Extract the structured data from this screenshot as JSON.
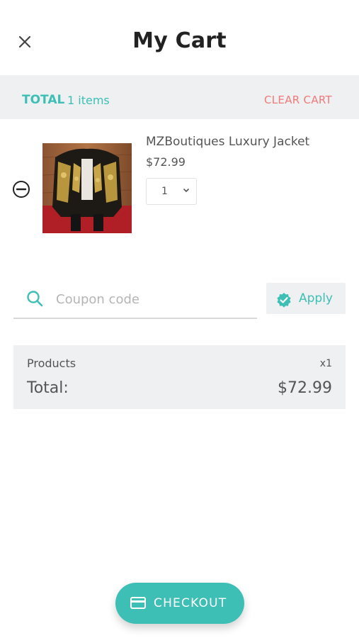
{
  "header": {
    "title": "My Cart",
    "close_icon": "close-icon"
  },
  "summary_bar": {
    "total_label": "TOTAL",
    "items_count": "1 items",
    "clear_cart_label": "CLEAR CART"
  },
  "cart_items": [
    {
      "name": "MZBoutiques Luxury Jacket",
      "price": "$72.99",
      "quantity": "1",
      "remove_icon": "remove-circle-icon",
      "image": "product-photo-jacket"
    }
  ],
  "coupon": {
    "placeholder": "Coupon code",
    "value": "",
    "search_icon": "search-icon",
    "apply_label": "Apply",
    "apply_icon": "verified-badge-icon"
  },
  "order_summary": {
    "products_label": "Products",
    "products_qty": "x1",
    "total_label": "Total:",
    "total_value": "$72.99"
  },
  "checkout": {
    "label": "CHECKOUT",
    "icon": "credit-card-icon"
  },
  "colors": {
    "accent": "#3dbfb6",
    "danger": "#f07a7a",
    "panel_bg": "#eef0f1",
    "text": "#555555"
  }
}
